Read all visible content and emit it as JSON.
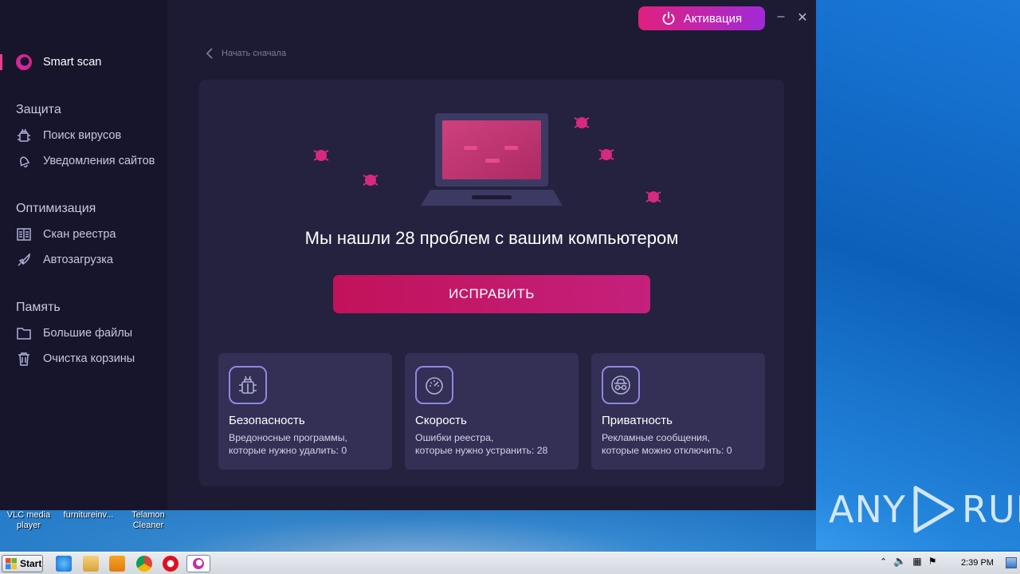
{
  "app": {
    "activation_label": "Активация",
    "back_label": "Начать сначала",
    "headline": "Мы нашли 28 проблем с вашим компьютером",
    "fix_label": "ИСПРАВИТЬ"
  },
  "sidebar": {
    "smart_scan": "Smart scan",
    "sections": [
      {
        "title": "Защита",
        "items": [
          "Поиск вирусов",
          "Уведомления сайтов"
        ]
      },
      {
        "title": "Оптимизация",
        "items": [
          "Скан реестра",
          "Автозагрузка"
        ]
      },
      {
        "title": "Память",
        "items": [
          "Большие файлы",
          "Очистка корзины"
        ]
      }
    ]
  },
  "tiles": [
    {
      "title": "Безопасность",
      "line1": "Вредоносные программы,",
      "line2": "которые нужно удалить: 0",
      "icon": "bug-icon"
    },
    {
      "title": "Скорость",
      "line1": "Ошибки реестра,",
      "line2": "которые нужно устранить: 28",
      "icon": "speedometer-icon"
    },
    {
      "title": "Приватность",
      "line1": "Рекламные сообщения,",
      "line2": "которые можно отключить: 0",
      "icon": "incognito-icon"
    }
  ],
  "desktop": {
    "icons": [
      "VLC media player",
      "furnitureinv...",
      "Telamon Cleaner"
    ],
    "watermark": "ANY RUN"
  },
  "taskbar": {
    "start_label": "Start",
    "clock": "2:39 PM"
  },
  "colors": {
    "accent": "#e0207e",
    "purple": "#a02ad8",
    "card": "#24223f",
    "sidebar": "#17152b"
  }
}
